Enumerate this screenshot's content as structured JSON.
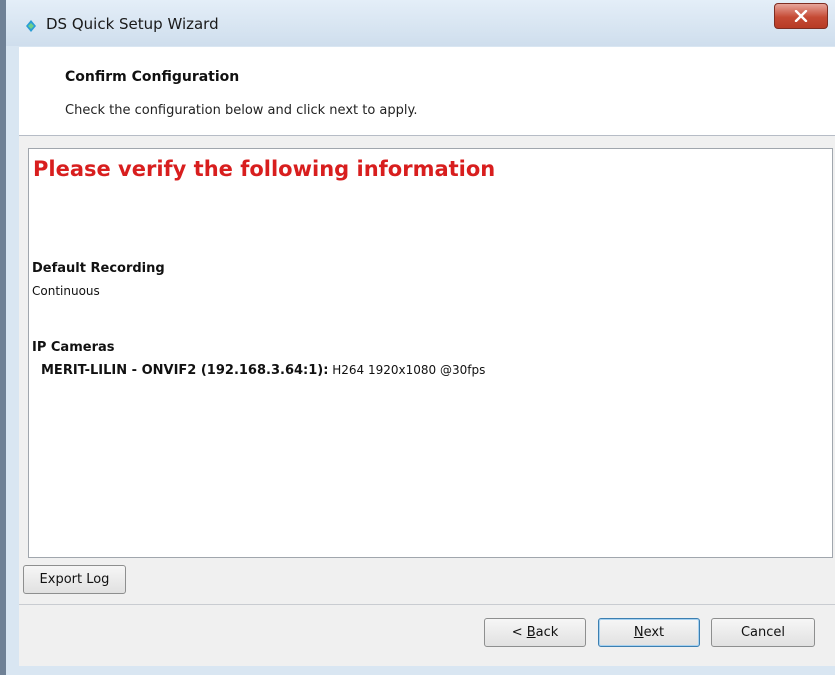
{
  "window": {
    "title": "DS Quick Setup Wizard",
    "close_icon": "close-x-icon",
    "app_icon": "ds-app-icon"
  },
  "header": {
    "title": "Confirm Configuration",
    "subtitle": "Check the configuration below and click next to apply."
  },
  "summary": {
    "heading": "Please verify the following information",
    "heading_color": "#d81e1e",
    "recording_label": "Default Recording",
    "recording_value": "Continuous",
    "cameras_label": "IP Cameras",
    "cameras": [
      {
        "name": "MERIT-LILIN - ONVIF2 (192.168.3.64:1):",
        "detail": "H264 1920x1080 @30fps"
      }
    ]
  },
  "buttons": {
    "export_log": "Export Log",
    "back_prefix": "< ",
    "back_mnemonic": "B",
    "back_rest": "ack",
    "next_mnemonic": "N",
    "next_rest": "ext",
    "cancel": "Cancel"
  },
  "colors": {
    "title_bar": "#d6e4f1",
    "close_button": "#c54a35",
    "accent_border": "#3c7fb1"
  }
}
